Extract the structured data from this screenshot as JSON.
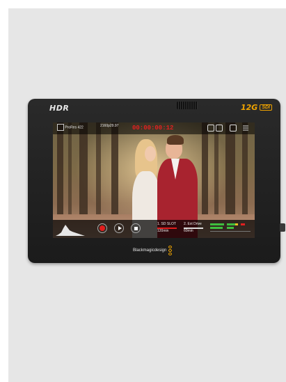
{
  "device": {
    "hdr_label": "HDR",
    "badge_main": "12G",
    "badge_sub": "SDI",
    "brand": "Blackmagicdesign",
    "colors": {
      "accent": "#f0a400",
      "record": "#e11d1d",
      "body": "#222222"
    }
  },
  "overlay": {
    "codec_label": "ProRes 422",
    "format_label": "2160p29.97",
    "timecode": "00:00:00:12",
    "slot1_label": "1. SD SLOT",
    "slot1_remaining": "120min",
    "slot2_label": "2. Ext Drive",
    "slot2_remaining": "60min"
  },
  "icons": [
    "hdr-logo",
    "record-icon",
    "play-icon",
    "stop-icon",
    "histogram-icon",
    "audio-meter-icon",
    "battery-icon",
    "menu-icon"
  ]
}
